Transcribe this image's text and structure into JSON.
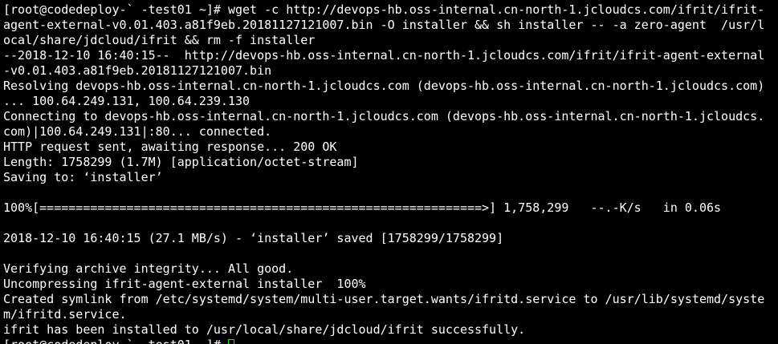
{
  "terminal": {
    "lines": [
      "[root@codedeploy-` -test01 ~]# wget -c http://devops-hb.oss-internal.cn-north-1.jcloudcs.com/ifrit/ifrit-",
      "agent-external-v0.01.403.a81f9eb.20181127121007.bin -O installer && sh installer -- -a zero-agent  /usr/l",
      "ocal/share/jdcloud/ifrit && rm -f installer",
      "--2018-12-10 16:40:15--  http://devops-hb.oss-internal.cn-north-1.jcloudcs.com/ifrit/ifrit-agent-external",
      "-v0.01.403.a81f9eb.20181127121007.bin",
      "Resolving devops-hb.oss-internal.cn-north-1.jcloudcs.com (devops-hb.oss-internal.cn-north-1.jcloudcs.com)",
      "... 100.64.249.131, 100.64.239.130",
      "Connecting to devops-hb.oss-internal.cn-north-1.jcloudcs.com (devops-hb.oss-internal.cn-north-1.jcloudcs.",
      "com)|100.64.249.131|:80... connected.",
      "HTTP request sent, awaiting response... 200 OK",
      "Length: 1758299 (1.7M) [application/octet-stream]",
      "Saving to: ‘installer’",
      "",
      "100%[=============================================================>] 1,758,299   --.-K/s   in 0.06s",
      "",
      "2018-12-10 16:40:15 (27.1 MB/s) - ‘installer’ saved [1758299/1758299]",
      "",
      "Verifying archive integrity... All good.",
      "Uncompressing ifrit-agent-external installer  100%",
      "Created symlink from /etc/systemd/system/multi-user.target.wants/ifritd.service to /usr/lib/systemd/syste",
      "m/ifritd.service.",
      "ifrit has been installed to /usr/local/share/jdcloud/ifrit successfully."
    ],
    "prompt_partial": "[root@codedeploy-` -test01 ~]# ",
    "colors": {
      "background": "#000000",
      "foreground": "#ffffff",
      "cursor": "#00ff00"
    }
  }
}
